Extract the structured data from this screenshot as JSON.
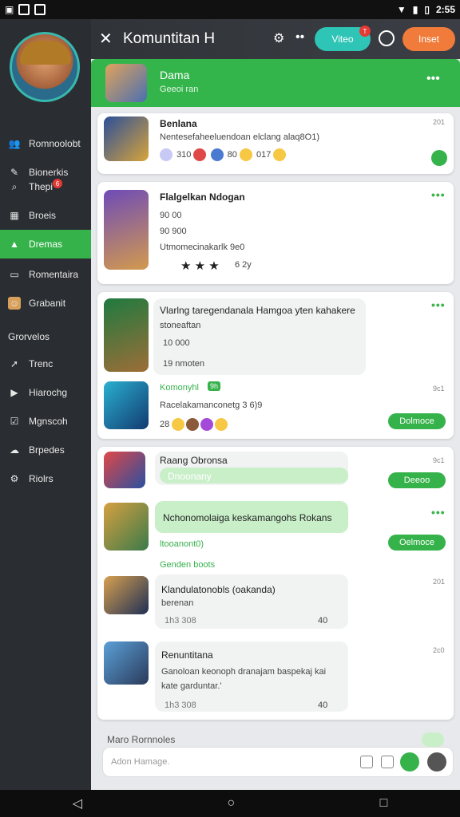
{
  "status": {
    "time": "2:55"
  },
  "sidebar": {
    "items": [
      {
        "label": "Romnoolobt",
        "icon": "people-icon"
      },
      {
        "label": "Bionerkis",
        "icon": "link-icon"
      },
      {
        "label": "Thepi",
        "icon": "search-icon",
        "badge": "6"
      },
      {
        "label": "Broeis",
        "icon": "grid-icon"
      },
      {
        "label": "Dremas",
        "icon": "tent-icon",
        "active": true
      },
      {
        "label": "Romentaira",
        "icon": "note-icon"
      },
      {
        "label": "Grabanit",
        "icon": "avatar-icon"
      },
      {
        "label": "Grorvelos",
        "icon": "none"
      },
      {
        "label": "Trenc",
        "icon": "share-icon"
      },
      {
        "label": "Hiarochg",
        "icon": "play-icon"
      },
      {
        "label": "Mgnscoh",
        "icon": "check-icon"
      },
      {
        "label": "Brpedes",
        "icon": "cloud-icon"
      },
      {
        "label": "Riolrs",
        "icon": "settings-icon"
      }
    ]
  },
  "topbar": {
    "title": "Komuntitan H",
    "pill1": "Viteo",
    "pill1_badge": "T",
    "pill2": "Inset"
  },
  "group": {
    "name": "Dama",
    "sub": "Geeoi ran"
  },
  "posts": [
    {
      "title": "Benlana",
      "line": "Nentesefaheeluendoan elclang alaq8O1)",
      "meta": "201",
      "counts": "310",
      "count2": "80",
      "count3": "017"
    },
    {
      "title": "Flalgelkan Ndogan",
      "l1": "90 00",
      "l2": "90 900",
      "l3": "Utmomecinakarlk 9e0",
      "stars": "★ ★ ★",
      "count": "6 2y"
    },
    {
      "title": "Vlarlng taregendanala Hamgoa yten kahakere",
      "line": "stoneaftan",
      "a": "10 000",
      "b": "19 nmoten"
    },
    {
      "tag": "Komonyhl",
      "tag2": "9h",
      "line": "Racelakamanconetg 3 6)9",
      "meta": "9c1",
      "count": "28",
      "btn": "Dolmoce"
    },
    {
      "title": "Raang Obronsa",
      "bubble": "Dnoonany",
      "btn": "Deeoo",
      "meta": "9c1"
    },
    {
      "title": "Nchonomolaiga keskamangohs Rokans",
      "tag": "ltooanont0)",
      "label": "Genden boots",
      "btn": "Oelmoce",
      "meta": "..."
    },
    {
      "title": "Klandulatonobls (oakanda)",
      "line": "berenan",
      "count": "1h3 308",
      "num": "40",
      "meta": "201"
    },
    {
      "title": "Renuntitana",
      "l1": "Ganoloan keonoph dranajam baspekaj kai",
      "l2": "kate garduntar.'",
      "count": "1h3 308",
      "num": "40",
      "meta": "2c0"
    }
  ],
  "footer": {
    "label": "Maro Rornnoles",
    "placeholder": "Adon Hamage."
  }
}
